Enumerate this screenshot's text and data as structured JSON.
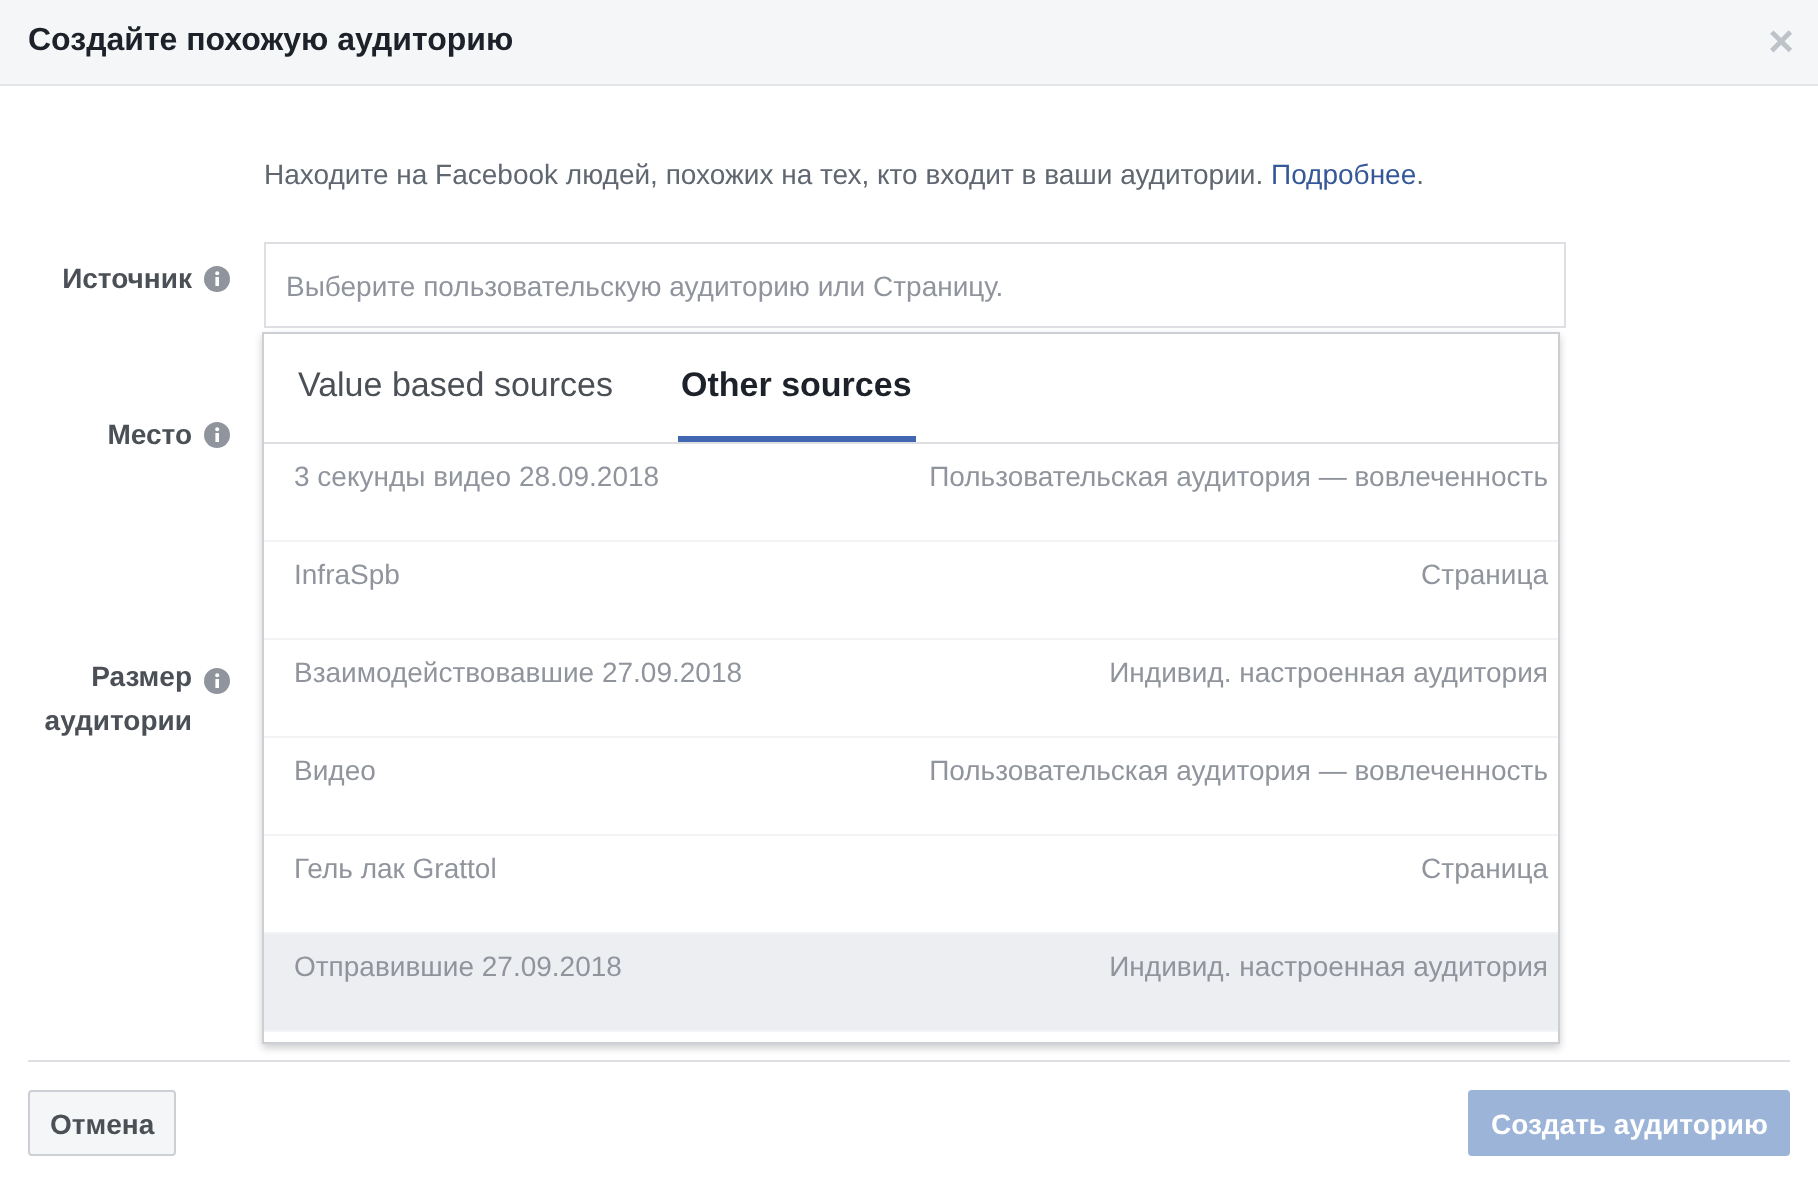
{
  "dialog": {
    "title": "Создайте похожую аудиторию",
    "close": "×"
  },
  "intro": {
    "text": "Находите на Facebook людей, похожих на тех, кто входит в ваши аудитории.",
    "link": "Подробнее",
    "end": "."
  },
  "fields": [
    {
      "label": "Источник",
      "placeholder": "Выберите пользовательскую аудиторию или Страницу."
    },
    {
      "label": "Место"
    },
    {
      "label": "Размер аудитории"
    }
  ],
  "dropdown": {
    "tabs": [
      {
        "label": "Value based sources",
        "selected": false
      },
      {
        "label": "Other sources",
        "selected": true
      }
    ],
    "items": [
      {
        "name": "3 секунды видео 28.09.2018",
        "type": "Пользовательская аудитория — вовлеченность",
        "hovered": false
      },
      {
        "name": "InfraSpb",
        "type": "Страница",
        "hovered": false
      },
      {
        "name": "Взаимодействовавшие 27.09.2018",
        "type": "Индивид. настроенная аудитория",
        "hovered": false
      },
      {
        "name": "Видео",
        "type": "Пользовательская аудитория — вовлеченность",
        "hovered": false
      },
      {
        "name": "Гель лак Grattol",
        "type": "Страница",
        "hovered": false
      },
      {
        "name": "Отправившие 27.09.2018",
        "type": "Индивид. настроенная аудитория",
        "hovered": true
      }
    ]
  },
  "buttons": [
    {
      "label": "Отмена",
      "disabled": false,
      "kind": "secondary"
    },
    {
      "label": "Создать аудиторию",
      "disabled": true,
      "kind": "primary"
    }
  ]
}
